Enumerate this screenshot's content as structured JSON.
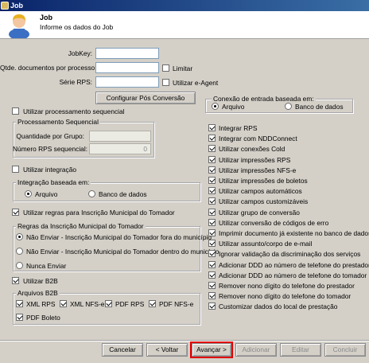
{
  "window": {
    "title": "Job"
  },
  "header": {
    "title": "Job",
    "subtitle": "Informe os dados do Job"
  },
  "fields": {
    "jobkey_label": "JobKey:",
    "qtde_label": "Qtde. documentos por processo:",
    "serie_label": "Série RPS:",
    "limitar": "Limitar",
    "utilizar_eagent": "Utilizar e-Agent",
    "configurar_pos": "Configurar Pós Conversão"
  },
  "processamento": {
    "utilizar_label": "Utilizar processamento sequencial",
    "group_title": "Processamento Sequencial",
    "quantidade_label": "Quantidade por Grupo:",
    "numero_label": "Número RPS sequencial:",
    "numero_value": "0"
  },
  "integracao": {
    "utilizar_label": "Utilizar integração",
    "group_title": "Integração baseada em:",
    "arquivo": "Arquivo",
    "banco": "Banco de dados"
  },
  "regras": {
    "utilizar_label": "Utilizar regras para Inscrição Municipal do Tomador",
    "group_title": "Regras da Inscrição Municipal do Tomador",
    "opt1": "Não Enviar - Inscrição Municipal do Tomador fora do município",
    "opt2": "Não Enviar - Inscrição Municipal do Tomador dentro do município",
    "opt3": "Nunca Enviar"
  },
  "b2b": {
    "utilizar_label": "Utilizar B2B",
    "group_title": "Arquivos B2B",
    "xml_rps": "XML RPS",
    "xml_nfse": "XML NFS-e",
    "pdf_rps": "PDF RPS",
    "pdf_nfse": "PDF NFS-e",
    "pdf_boleto": "PDF Boleto"
  },
  "conexao": {
    "group_title": "Conexão de entrada baseada em:",
    "arquivo": "Arquivo",
    "banco": "Banco de dados"
  },
  "options": [
    {
      "label": "Integrar RPS",
      "checked": true
    },
    {
      "label": "Integrar com NDDConnect",
      "checked": true
    },
    {
      "label": "Utilizar conexões Cold",
      "checked": true
    },
    {
      "label": "Utilizar impressões RPS",
      "checked": true
    },
    {
      "label": "Utilizar impressões NFS-e",
      "checked": true
    },
    {
      "label": "Utilizar impressões de boletos",
      "checked": true
    },
    {
      "label": "Utilizar campos automáticos",
      "checked": true
    },
    {
      "label": "Utilizar campos customizáveis",
      "checked": true
    },
    {
      "label": "Utilizar grupo de conversão",
      "checked": true
    },
    {
      "label": "Utilizar conversão de códigos de erro",
      "checked": true
    },
    {
      "label": "Imprimir documento já existente no banco de dados",
      "checked": true
    },
    {
      "label": "Utilizar assunto/corpo de e-mail",
      "checked": true
    },
    {
      "label": "Ignorar validação da discriminação dos serviços",
      "checked": true
    },
    {
      "label": "Adicionar DDD ao número de telefone do prestador",
      "checked": true
    },
    {
      "label": "Adicionar DDD ao número de telefone do tomador",
      "checked": true
    },
    {
      "label": "Remover nono dígito do telefone do prestador",
      "checked": true
    },
    {
      "label": "Remover nono dígito do telefone do tomador",
      "checked": true
    },
    {
      "label": "Customizar dados do local de prestação",
      "checked": true
    }
  ],
  "buttons": {
    "cancelar": "Cancelar",
    "voltar": "< Voltar",
    "avancar": "Avançar >",
    "adicionar": "Adicionar",
    "editar": "Editar",
    "concluir": "Concluir"
  },
  "colors": {
    "highlight": "#e00000",
    "titlebar": "#0a246a"
  },
  "icons": {
    "window": "job-icon",
    "header": "user-icon"
  }
}
